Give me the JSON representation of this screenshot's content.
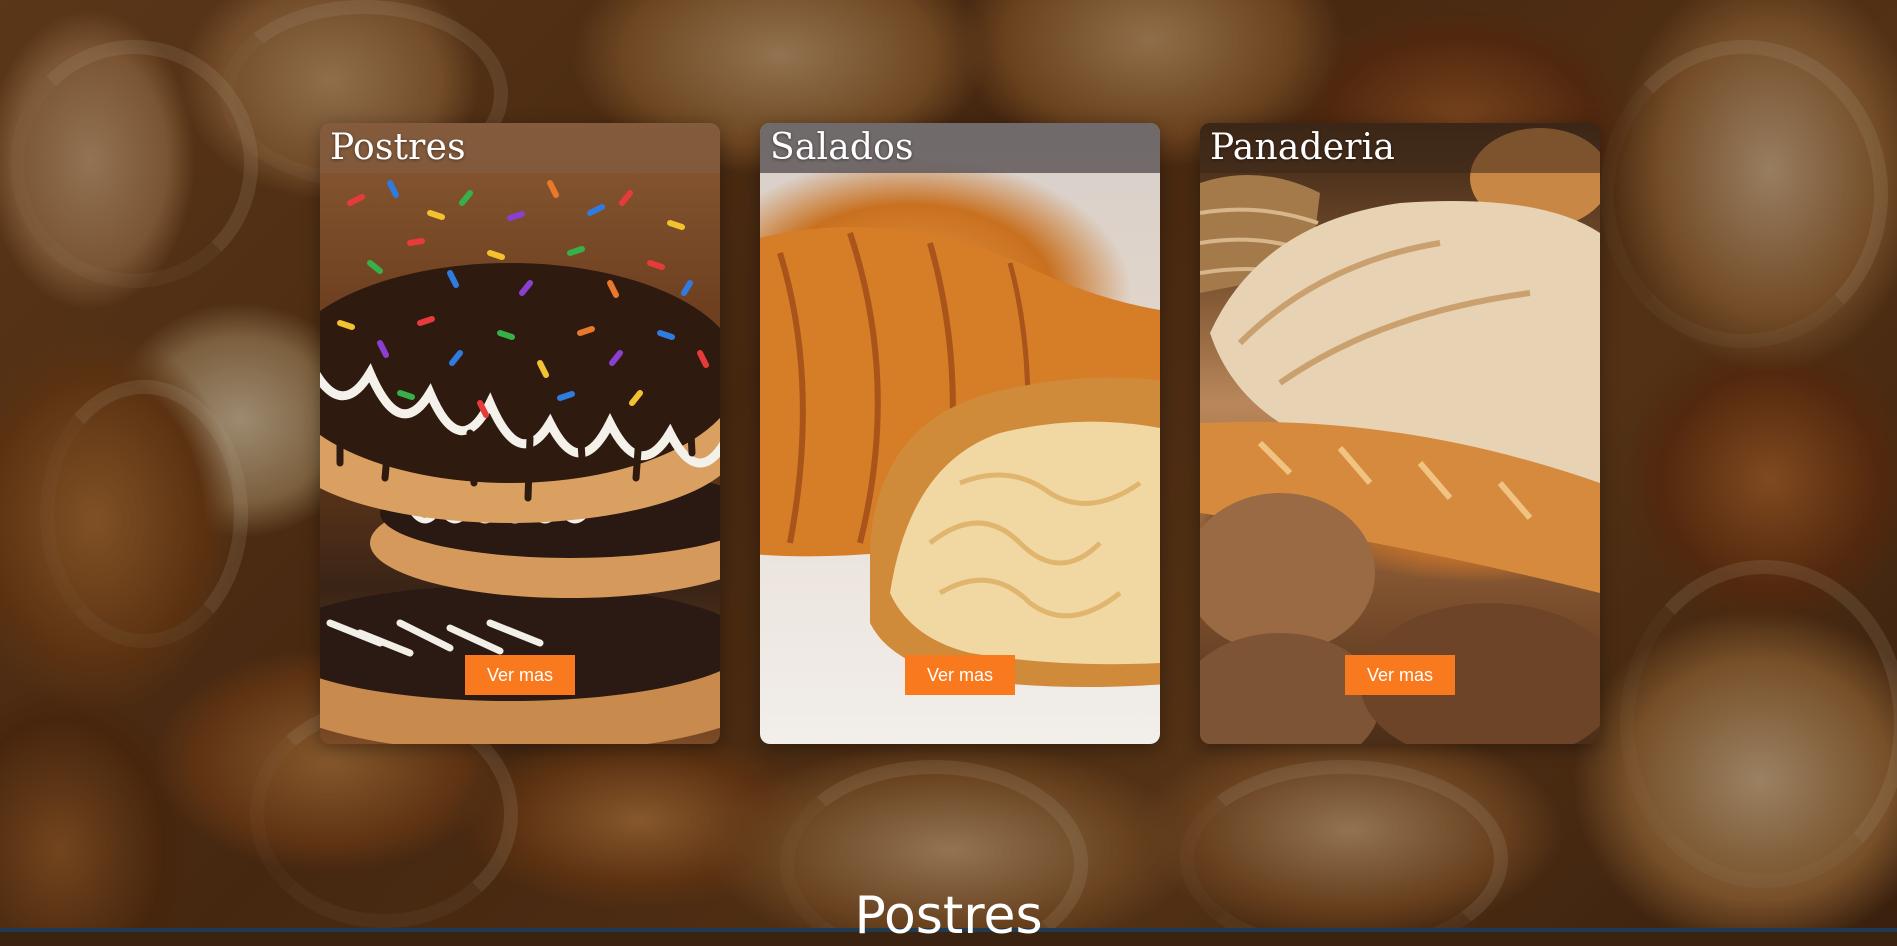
{
  "cards": [
    {
      "title": "Postres",
      "button_label": "Ver mas",
      "image_subject": "stacked sprinkle donuts"
    },
    {
      "title": "Salados",
      "button_label": "Ver mas",
      "image_subject": "croissants"
    },
    {
      "title": "Panaderia",
      "button_label": "Ver mas",
      "image_subject": "assorted bread loaves"
    }
  ],
  "section_heading": "Postres",
  "colors": {
    "button_bg": "#f97a1e",
    "button_text": "#ffffff",
    "card_title": "#ffffff",
    "bottom_bar": "#1f3a52"
  }
}
